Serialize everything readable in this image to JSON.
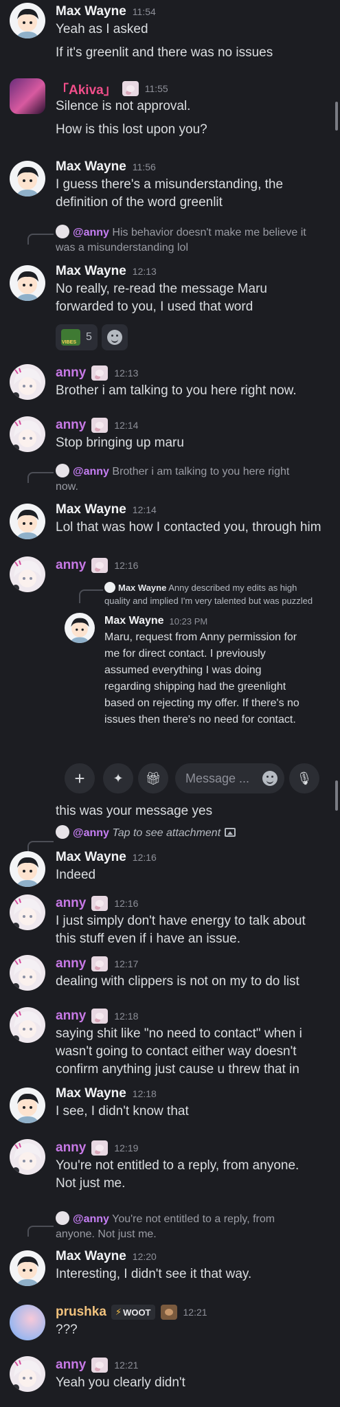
{
  "users": {
    "max": "Max Wayne",
    "akiva": "「Akiva」",
    "anny": "anny",
    "prushka": "prushka"
  },
  "messages": [
    {
      "user": "Max Wayne",
      "time": "11:54",
      "lines": [
        "Yeah as I asked",
        "If it's greenlit and there was no issues"
      ]
    },
    {
      "user": "「Akiva」",
      "time": "11:55",
      "lines": [
        "Silence is not approval.",
        "How is this lost upon you?"
      ]
    },
    {
      "user": "Max Wayne",
      "time": "11:56",
      "lines": [
        "I guess there's a misunderstanding, the",
        "definition of the word greenlit"
      ]
    },
    {
      "reply": {
        "mention": "@anny",
        "text_line1": "His behavior doesn't make me believe it",
        "text_line2": "was a misunderstanding lol"
      },
      "user": "Max Wayne",
      "time": "12:13",
      "lines": [
        "No really, re-read the message Maru",
        "forwarded to you, I used that word"
      ]
    },
    {
      "user": "anny",
      "time": "12:13",
      "lines": [
        "Brother i am talking to you here right now."
      ]
    },
    {
      "user": "anny",
      "time": "12:14",
      "lines": [
        "Stop bringing up maru"
      ]
    },
    {
      "reply": {
        "mention": "@anny",
        "text_line1": "Brother i am talking to you here right",
        "text_line2": "now."
      },
      "user": "Max Wayne",
      "time": "12:14",
      "lines": [
        "Lol that was how I contacted you, through him"
      ]
    },
    {
      "user": "anny",
      "time": "12:16"
    },
    {
      "user": "Max Wayne",
      "time": "12:16",
      "reply": {
        "mention": "@anny",
        "text": "Tap to see attachment"
      },
      "lines": [
        "Indeed"
      ]
    },
    {
      "user": "anny",
      "time": "12:16",
      "lines": [
        "I just simply don't have energy to talk about",
        "this stuff even if i have an issue."
      ]
    },
    {
      "user": "anny",
      "time": "12:17",
      "lines": [
        "dealing with clippers is not on my to do list"
      ]
    },
    {
      "user": "anny",
      "time": "12:18",
      "lines": [
        "saying shit like \"no need to contact\" when i",
        "wasn't going to contact either way doesn't",
        "confirm anything just cause u threw that in"
      ]
    },
    {
      "user": "Max Wayne",
      "time": "12:18",
      "lines": [
        "I see, I didn't know that"
      ]
    },
    {
      "user": "anny",
      "time": "12:19",
      "lines": [
        "You're not entitled to a reply, from anyone.",
        "Not just me."
      ]
    },
    {
      "reply": {
        "mention": "@anny",
        "text_line1": "You're not entitled to a reply, from",
        "text_line2": "anyone. Not just me."
      },
      "user": "Max Wayne",
      "time": "12:20",
      "lines": [
        "Interesting, I didn't see it that way."
      ]
    },
    {
      "user": "prushka",
      "badge": "WOOT",
      "time": "12:21",
      "lines": [
        "???"
      ]
    },
    {
      "user": "anny",
      "time": "12:21",
      "lines": [
        "Yeah you clearly didn't"
      ]
    }
  ],
  "reactions": [
    {
      "name": "vibes-pepe",
      "count": "5"
    }
  ],
  "forward": {
    "reply_author": "Max Wayne",
    "reply_text_line1": "Anny described my edits as high",
    "reply_text_line2": "quality and implied I'm very talented but was puzzled",
    "author": "Max Wayne",
    "time": "10:23 PM",
    "lines": [
      "Maru, request from Anny permission for",
      "me for direct contact. I previously",
      "assumed everything I was doing",
      "regarding shipping had the greenlight",
      "based on rejecting my offer. If there's no",
      "issues then there's no need for contact."
    ]
  },
  "composer": {
    "placeholder": "Message ..."
  },
  "after_composer_text": "this was your message yes"
}
